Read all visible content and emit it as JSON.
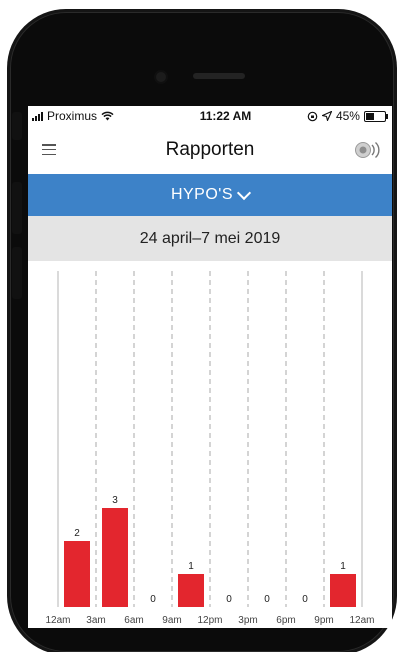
{
  "status": {
    "carrier": "Proximus",
    "time": "11:22 AM",
    "battery": "45%",
    "battery_level": 0.45
  },
  "header": {
    "title": "Rapporten",
    "menu_icon": "hamburger-menu-icon",
    "right_icon": "sensor-signal-icon"
  },
  "selector": {
    "label": "HYPO'S"
  },
  "date_range": "24 april–7 mei 2019",
  "colors": {
    "accent": "#3d82c8",
    "bar": "#e3262e",
    "date_bar": "#e4e4e4"
  },
  "chart_data": {
    "type": "bar",
    "categories": [
      "12am-3am",
      "3am-6am",
      "6am-9am",
      "9am-12pm",
      "12pm-3pm",
      "3pm-6pm",
      "6pm-9pm",
      "9pm-12am"
    ],
    "values": [
      2,
      3,
      0,
      1,
      0,
      0,
      0,
      1
    ],
    "x_tick_labels": [
      "12am",
      "3am",
      "6am",
      "9am",
      "12pm",
      "3pm",
      "6pm",
      "9pm",
      "12am"
    ],
    "grid": "vertical dashed",
    "ylim": [
      0,
      3
    ]
  }
}
